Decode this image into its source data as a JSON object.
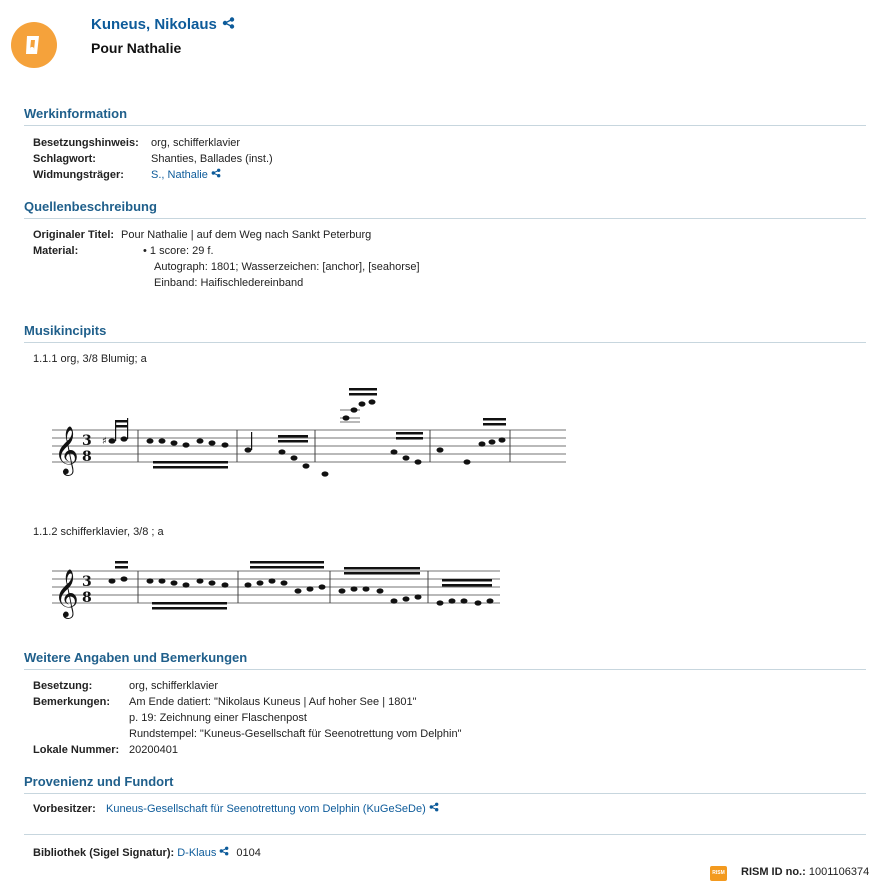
{
  "header": {
    "author": "Kuneus, Nikolaus",
    "title": "Pour Nathalie"
  },
  "work": {
    "heading": "Werkinformation",
    "rows": [
      {
        "label": "Besetzungshinweis:",
        "value": "org, schifferklavier"
      },
      {
        "label": "Schlagwort:",
        "value": "Shanties, Ballades (inst.)"
      },
      {
        "label": "Widmungsträger:",
        "value": "S., Nathalie"
      }
    ]
  },
  "source": {
    "heading": "Quellenbeschreibung",
    "original_title_label": "Originaler Titel:",
    "original_title": "Pour Nathalie | auf dem Weg nach Sankt Peterburg",
    "material_label": "Material:",
    "material_lines": [
      "1 score: 29 f.",
      "Autograph: 1801; Wasserzeichen: [anchor], [seahorse]",
      "Einband: Haifischledereinband"
    ]
  },
  "incipits": {
    "heading": "Musikincipits",
    "items": [
      {
        "label": "1.1.1 org, 3/8 Blumig; a"
      },
      {
        "label": "1.1.2 schifferklavier, 3/8 ; a"
      }
    ]
  },
  "further": {
    "heading": "Weitere Angaben und Bemerkungen",
    "besetzung_label": "Besetzung:",
    "besetzung": "org, schifferklavier",
    "bemerkungen_label": "Bemerkungen:",
    "bemerkungen": [
      "Am Ende datiert: \"Nikolaus Kuneus | Auf hoher See | 1801\"",
      "p. 19: Zeichnung einer Flaschenpost",
      "Rundstempel: \"Kuneus-Gesellschaft für Seenotrettung vom Delphin\""
    ],
    "lokale_label": "Lokale Nummer:",
    "lokale": "20200401"
  },
  "provenance": {
    "heading": "Provenienz und Fundort",
    "vorbesitzer_label": "Vorbesitzer:",
    "vorbesitzer": "Kuneus-Gesellschaft für Seenotrettung vom Delphin (KuGeSeDe)"
  },
  "footer": {
    "library_label": "Bibliothek (Sigel Signatur):",
    "library_link": "D-Klaus",
    "shelfmark": "0104",
    "rism_icon": "RISM",
    "rism_label": "RISM ID no.:",
    "rism_id": "1001106374"
  },
  "colors": {
    "accent": "#0d5b9a",
    "heading": "#1f5f8b",
    "logo": "#f5a23b"
  },
  "icons": [
    "logo-icon",
    "share-icon",
    "rism-badge-icon"
  ]
}
